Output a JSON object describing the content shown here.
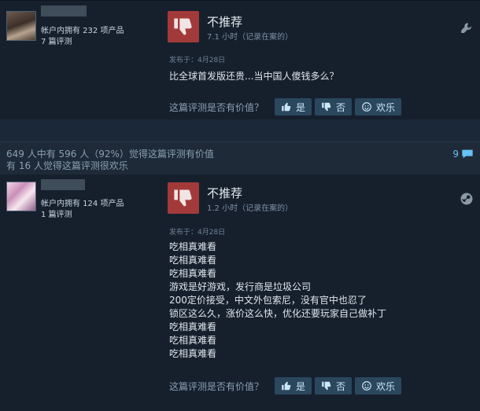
{
  "reviews": [
    {
      "owned_products": "帐户内拥有 232 项产品",
      "review_count": "7 篇评测",
      "verdict": "不推荐",
      "hours": "7.1 小时（记录在案的）",
      "posted": "发布于：4月28日",
      "body": [
        "比全球首发版还贵...当中国人傻钱多么？"
      ],
      "helpful_question": "这篇评测是否有价值？",
      "buttons": {
        "yes": "是",
        "no": "否",
        "funny": "欢乐"
      }
    },
    {
      "owned_products": "帐户内拥有 124 项产品",
      "review_count": "1 篇评测",
      "verdict": "不推荐",
      "hours": "1.2 小时（记录在案的）",
      "posted": "发布于：4月28日",
      "body": [
        "吃相真难看",
        "吃相真难看",
        "吃相真难看",
        "游戏是好游戏，发行商是垃圾公司",
        "200定价接受，中文外包索尼，没有官中也忍了",
        "锁区这么久，涨价这么快，优化还要玩家自己做补丁",
        "吃相真难看",
        "吃相真难看",
        "吃相真难看"
      ],
      "helpful_question": "这篇评测是否有价值？",
      "buttons": {
        "yes": "是",
        "no": "否",
        "funny": "欢乐"
      }
    }
  ],
  "stats": {
    "helpful_line": "649 人中有 596 人（92%）觉得这篇评测有价值",
    "funny_line": "有 16 人觉得这篇评测很欢乐",
    "comment_count": "9"
  },
  "icons": {
    "thumbs_down": "thumbs-down-icon",
    "comment": "comment-icon",
    "tool": "wrench-icon",
    "steam": "steam-logo-icon"
  },
  "colors": {
    "negative": "#a33a3a",
    "button": "#2a475e",
    "link": "#66c0f4"
  }
}
